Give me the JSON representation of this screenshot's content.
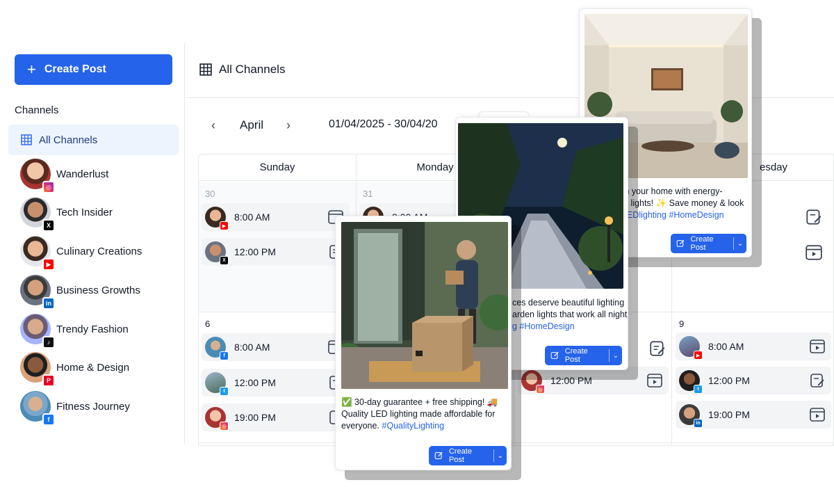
{
  "sidebar": {
    "create_label": "Create Post",
    "channels_title": "Channels",
    "all_channels": "All Channels",
    "channels": [
      {
        "name": "Wanderlust",
        "network": "instagram-icon"
      },
      {
        "name": "Tech Insider",
        "network": "x-icon"
      },
      {
        "name": "Culinary Creations",
        "network": "youtube-icon"
      },
      {
        "name": "Business Growths",
        "network": "linkedin-icon"
      },
      {
        "name": "Trendy Fashion",
        "network": "tiktok-icon"
      },
      {
        "name": "Home & Design",
        "network": "pinterest-icon"
      },
      {
        "name": "Fitness Journey",
        "network": "facebook-icon"
      }
    ]
  },
  "header": {
    "title": "All Channels"
  },
  "calendar": {
    "month": "April",
    "range": "01/04/2025 - 30/04/20",
    "days": [
      "Sunday",
      "Monday",
      "esday"
    ],
    "dates": {
      "d30": "30",
      "d31": "31",
      "d6": "6",
      "d9": "9"
    },
    "posts": {
      "sun30_1": "8:00 AM",
      "sun30_2": "12:00 PM",
      "mon31_1": "8:00 AM",
      "sun6_1": "8:00 AM",
      "sun6_2": "12:00 PM",
      "sun6_3": "19:00 PM",
      "wed_1": "12:00 PM",
      "thu9_1": "8:00 AM",
      "thu9_2": "12:00 PM",
      "thu9_3": "19:00 PM"
    }
  },
  "cards": {
    "front": {
      "line1": "✅ 30-day guarantee + free shipping! 🚚",
      "line2": "Quality LED lighting made affordable for",
      "line3": "everyone.",
      "tag": "#QualityLighting",
      "button": "Create Post"
    },
    "middle": {
      "line1": "ces deserve beautiful lighting",
      "line2": "arden lights that work all night.",
      "tag_prefix": "g",
      "tag": "#HomeDesign",
      "button": "Create Post"
    },
    "back": {
      "line1": "m your home with energy-",
      "line2": "D lights! ✨ Save money & look",
      "tags": "LEDlighting #HomeDesign",
      "button": "Create Post"
    }
  },
  "colors": {
    "accent": "#2563eb",
    "instagram": "#e1306c",
    "youtube": "#ff0000",
    "linkedin": "#0a66c2",
    "pinterest": "#e60023",
    "facebook": "#1877f2",
    "x": "#000000",
    "tiktok": "#111111"
  }
}
